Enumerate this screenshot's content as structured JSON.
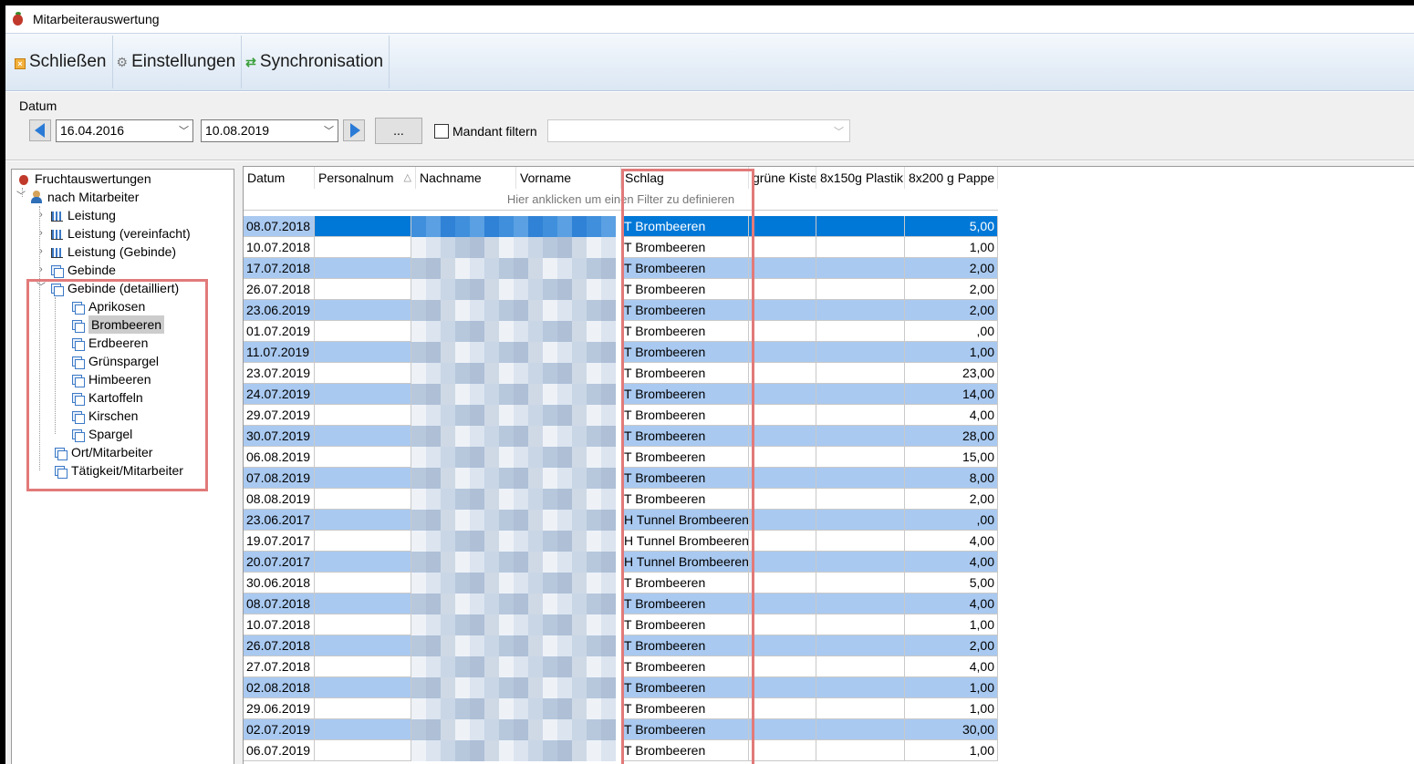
{
  "window": {
    "title": "Mitarbeiterauswertung"
  },
  "toolbar": {
    "close_label": "Schließen",
    "settings_label": "Einstellungen",
    "sync_label": "Synchronisation"
  },
  "filter": {
    "section_label": "Datum",
    "date_from": "16.04.2016",
    "date_to": "10.08.2019",
    "more_label": "...",
    "mandant_checked": false,
    "mandant_label": "Mandant filtern",
    "mandant_value": ""
  },
  "tree": {
    "root": "Fruchtauswertungen",
    "group": "nach Mitarbeiter",
    "items": [
      {
        "label": "Leistung",
        "icon": "chart-icon"
      },
      {
        "label": "Leistung (vereinfacht)",
        "icon": "chart-icon"
      },
      {
        "label": "Leistung (Gebinde)",
        "icon": "chart-icon"
      },
      {
        "label": "Gebinde",
        "icon": "box-icon"
      },
      {
        "label": "Gebinde (detailliert)",
        "icon": "box-icon"
      }
    ],
    "sub_items": [
      "Aprikosen",
      "Brombeeren",
      "Erdbeeren",
      "Grünspargel",
      "Himbeeren",
      "Kartoffeln",
      "Kirschen",
      "Spargel"
    ],
    "selected": "Brombeeren",
    "tail_items": [
      "Ort/Mitarbeiter",
      "Tätigkeit/Mitarbeiter"
    ]
  },
  "grid": {
    "columns": [
      "Datum",
      "Personalnum",
      "Nachname",
      "Vorname",
      "Schlag",
      "grüne Kiste",
      "8x150g Plastik",
      "8x200 g Pappe"
    ],
    "filter_hint": "Hier anklicken um einen Filter zu definieren",
    "rows": [
      {
        "datum": "08.07.2018",
        "schlag": "T Brombeeren",
        "pappe": "5,00"
      },
      {
        "datum": "10.07.2018",
        "schlag": "T Brombeeren",
        "pappe": "1,00"
      },
      {
        "datum": "17.07.2018",
        "schlag": "T Brombeeren",
        "pappe": "2,00"
      },
      {
        "datum": "26.07.2018",
        "schlag": "T Brombeeren",
        "pappe": "2,00"
      },
      {
        "datum": "23.06.2019",
        "schlag": "T Brombeeren",
        "pappe": "2,00"
      },
      {
        "datum": "01.07.2019",
        "schlag": "T Brombeeren",
        "pappe": ",00"
      },
      {
        "datum": "11.07.2019",
        "schlag": "T Brombeeren",
        "pappe": "1,00"
      },
      {
        "datum": "23.07.2019",
        "schlag": "T Brombeeren",
        "pappe": "23,00"
      },
      {
        "datum": "24.07.2019",
        "schlag": "T Brombeeren",
        "pappe": "14,00"
      },
      {
        "datum": "29.07.2019",
        "schlag": "T Brombeeren",
        "pappe": "4,00"
      },
      {
        "datum": "30.07.2019",
        "schlag": "T Brombeeren",
        "pappe": "28,00"
      },
      {
        "datum": "06.08.2019",
        "schlag": "T Brombeeren",
        "pappe": "15,00"
      },
      {
        "datum": "07.08.2019",
        "schlag": "T Brombeeren",
        "pappe": "8,00"
      },
      {
        "datum": "08.08.2019",
        "schlag": "T Brombeeren",
        "pappe": "2,00"
      },
      {
        "datum": "23.06.2017",
        "schlag": "H Tunnel Brombeeren",
        "pappe": ",00"
      },
      {
        "datum": "19.07.2017",
        "schlag": "H Tunnel Brombeeren",
        "pappe": "4,00"
      },
      {
        "datum": "20.07.2017",
        "schlag": "H Tunnel Brombeeren",
        "pappe": "4,00"
      },
      {
        "datum": "30.06.2018",
        "schlag": "T Brombeeren",
        "pappe": "5,00"
      },
      {
        "datum": "08.07.2018",
        "schlag": "T Brombeeren",
        "pappe": "4,00"
      },
      {
        "datum": "10.07.2018",
        "schlag": "T Brombeeren",
        "pappe": "1,00"
      },
      {
        "datum": "26.07.2018",
        "schlag": "T Brombeeren",
        "pappe": "2,00"
      },
      {
        "datum": "27.07.2018",
        "schlag": "T Brombeeren",
        "pappe": "4,00"
      },
      {
        "datum": "02.08.2018",
        "schlag": "T Brombeeren",
        "pappe": "1,00"
      },
      {
        "datum": "29.06.2019",
        "schlag": "T Brombeeren",
        "pappe": "1,00"
      },
      {
        "datum": "02.07.2019",
        "schlag": "T Brombeeren",
        "pappe": "30,00"
      },
      {
        "datum": "06.07.2019",
        "schlag": "T Brombeeren",
        "pappe": "1,00"
      }
    ]
  },
  "colors": {
    "selection": "#0078d7",
    "alt_row": "#a9c9f0",
    "annotation": "#e27a7a"
  }
}
